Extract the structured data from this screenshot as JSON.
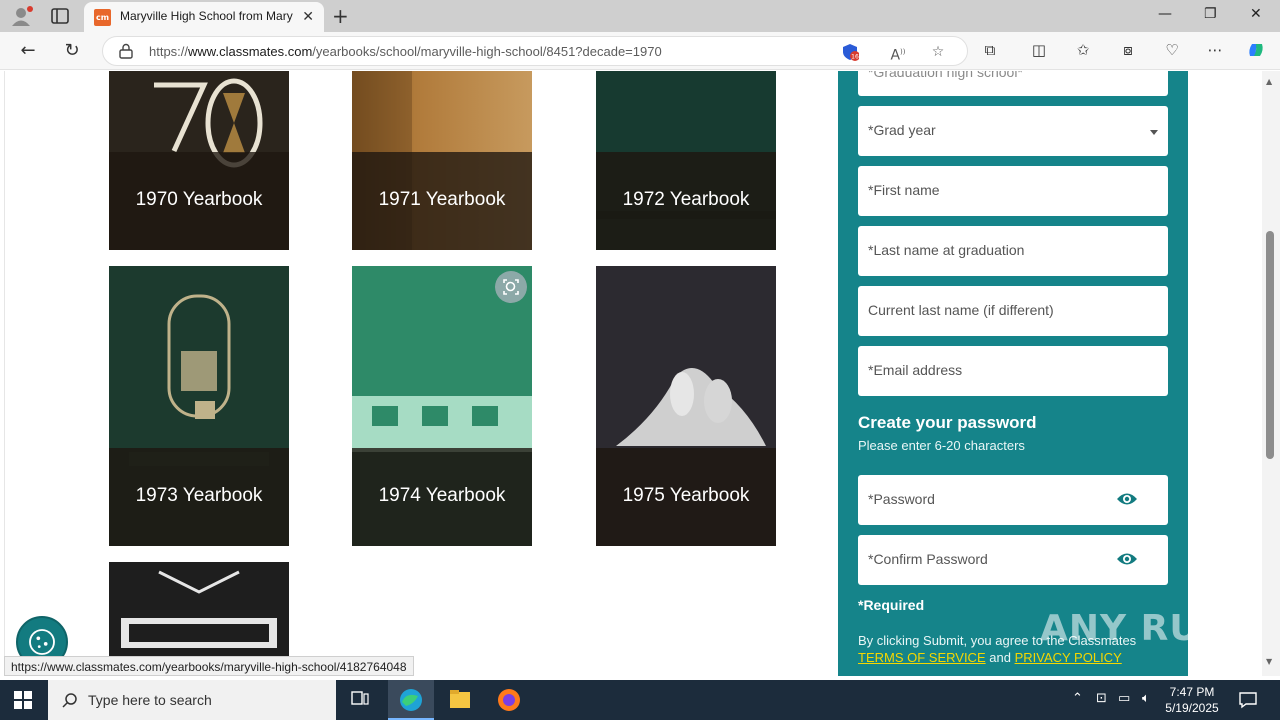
{
  "browser": {
    "tab_title": "Maryville High School from Mary",
    "tab_favicon_text": "cm",
    "url_prefix": "https://",
    "url_domain": "www.classmates.com",
    "url_path": "/yearbooks/school/maryville-high-school/8451?decade=1970",
    "extension_badge": "16"
  },
  "yearbooks": [
    {
      "label": "1970 Yearbook",
      "cover_color": "#2a241c"
    },
    {
      "label": "1971 Yearbook",
      "cover_color": "#b07a3a"
    },
    {
      "label": "1972 Yearbook",
      "cover_color": "#173a30"
    },
    {
      "label": "1973 Yearbook",
      "cover_color": "#1c3a2e"
    },
    {
      "label": "1974 Yearbook",
      "cover_color": "#2e8a68"
    },
    {
      "label": "1975 Yearbook",
      "cover_color": "#2c2a30"
    },
    {
      "cover_color": "#1e1e1e"
    }
  ],
  "form": {
    "school_placeholder": "*Graduation high school*",
    "grad_year_placeholder": "*Grad year",
    "first_name_placeholder": "*First name",
    "last_name_placeholder": "*Last name at graduation",
    "current_last_name_placeholder": "Current last name (if different)",
    "email_placeholder": "*Email address",
    "password_heading": "Create your password",
    "password_hint": "Please enter 6-20 characters",
    "password_placeholder": "*Password",
    "confirm_password_placeholder": "*Confirm Password",
    "required_label": "*Required",
    "legal_text": "By clicking Submit, you agree to the Classmates",
    "terms_link": "TERMS OF SERVICE",
    "legal_and": "and",
    "privacy_link": "PRIVACY POLICY"
  },
  "status_bar_url": "https://www.classmates.com/yearbooks/maryville-high-school/4182764048",
  "watermark": "ANY RUN",
  "taskbar": {
    "search_placeholder": "Type here to search",
    "time": "7:47 PM",
    "date": "5/19/2025"
  },
  "colors": {
    "panel": "#15848a",
    "link": "#f5d700",
    "taskbar": "#1c2c3c"
  }
}
